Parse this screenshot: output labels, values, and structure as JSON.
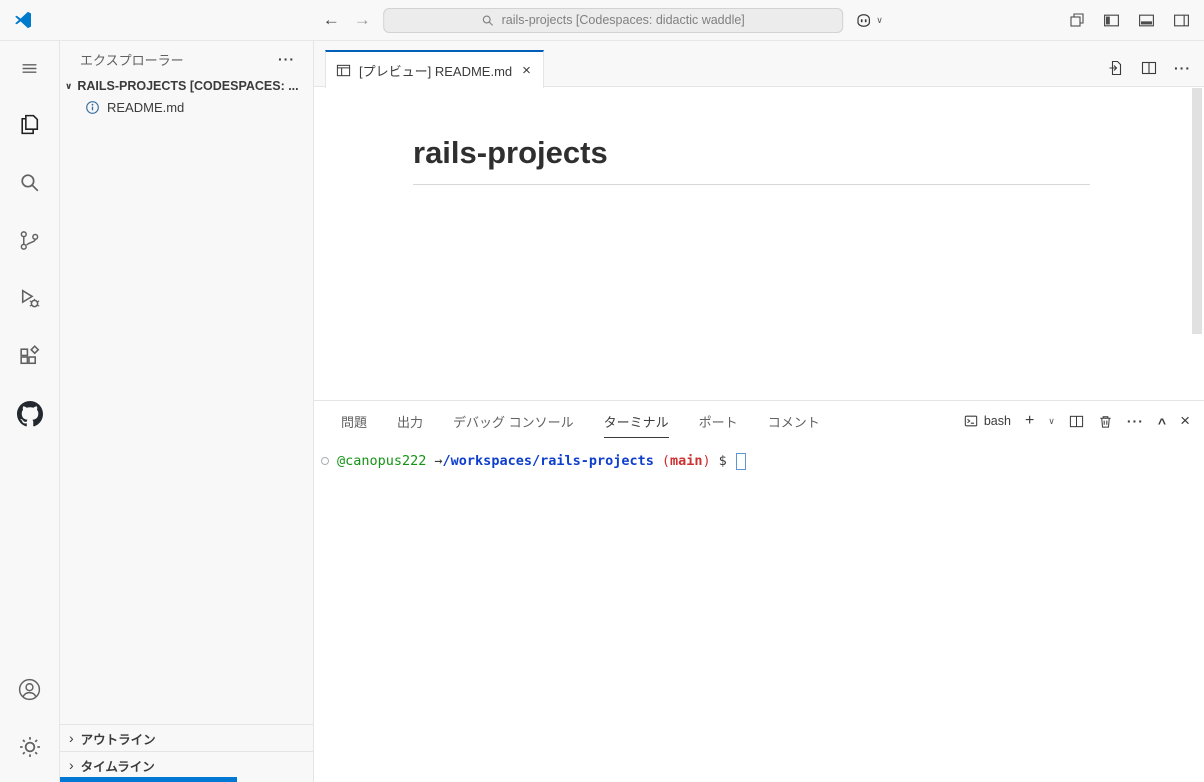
{
  "colors": {
    "accent_blue": "#005fb8",
    "statusbar_blue": "#0078d4",
    "terminal_green": "#149414",
    "terminal_blue": "#0e3ecc",
    "terminal_red": "#cd3131"
  },
  "glyphs": {
    "back_arrow": "←",
    "forward_arrow": "→",
    "chevron_down": "∨",
    "chevron_right": "›",
    "chevron_up": "^",
    "close": "×",
    "plus": "+",
    "more": "···"
  },
  "titlebar": {
    "search_label": "rails-projects [Codespaces: didactic waddle]"
  },
  "sidebar": {
    "header": "エクスプローラー",
    "workspace_label": "RAILS-PROJECTS [CODESPACES: ...",
    "files": [
      {
        "name": "README.md"
      }
    ],
    "outline_label": "アウトライン",
    "timeline_label": "タイムライン"
  },
  "editor": {
    "tab_label": "[プレビュー] README.md",
    "preview_heading": "rails-projects"
  },
  "panel": {
    "tabs": [
      {
        "label": "問題"
      },
      {
        "label": "出力"
      },
      {
        "label": "デバッグ コンソール"
      },
      {
        "label": "ターミナル"
      },
      {
        "label": "ポート"
      },
      {
        "label": "コメント"
      }
    ],
    "shell_label": "bash",
    "terminal": {
      "user": "@canopus222",
      "arrow": "→",
      "path": "/workspaces/rails-projects",
      "branch_open": "(",
      "branch": "main",
      "branch_close": ")",
      "dollar": "$"
    }
  }
}
